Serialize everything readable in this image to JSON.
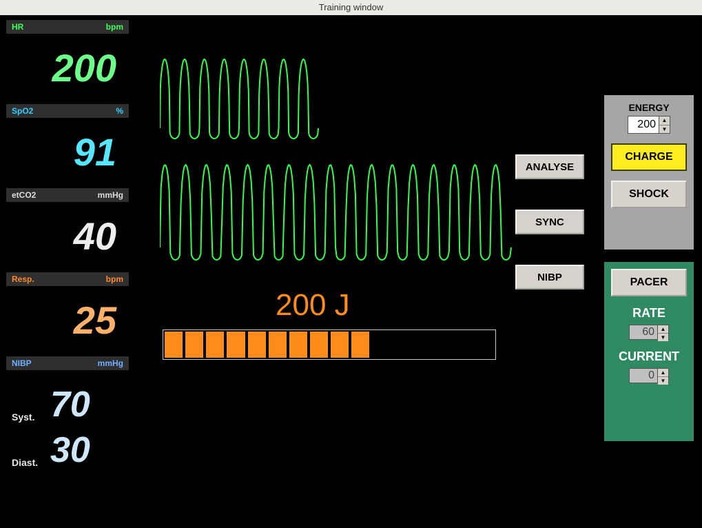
{
  "window": {
    "title": "Training window"
  },
  "vitals": {
    "hr": {
      "label": "HR",
      "unit": "bpm",
      "value": "200"
    },
    "spo2": {
      "label": "SpO2",
      "unit": "%",
      "value": "91"
    },
    "etco2": {
      "label": "etCO2",
      "unit": "mmHg",
      "value": "40"
    },
    "resp": {
      "label": "Resp.",
      "unit": "bpm",
      "value": "25"
    },
    "nibp": {
      "label": "NIBP",
      "unit": "mmHg",
      "syst_label": "Syst.",
      "syst_value": "70",
      "diast_label": "Diast.",
      "diast_value": "30"
    }
  },
  "buttons": {
    "analyse": "ANALYSE",
    "sync": "SYNC",
    "nibp": "NIBP"
  },
  "defib": {
    "energy_title": "ENERGY",
    "energy_value": "200",
    "charge": "CHARGE",
    "shock": "SHOCK",
    "display": "200 J",
    "progress_segments": 16,
    "progress_filled": 10
  },
  "pacer": {
    "button": "PACER",
    "rate_label": "RATE",
    "rate_value": "60",
    "current_label": "CURRENT",
    "current_value": "0"
  }
}
